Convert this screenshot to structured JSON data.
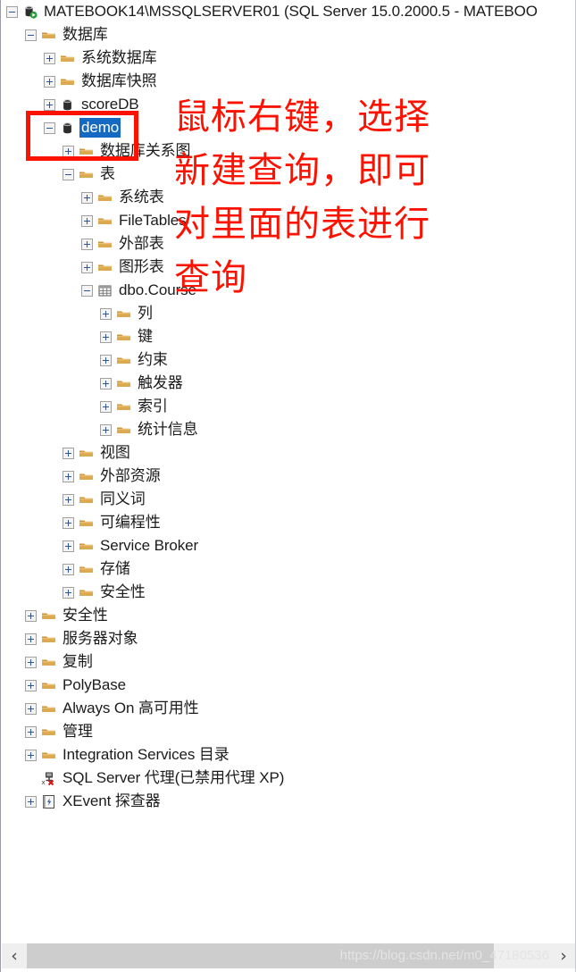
{
  "window": {
    "kind": "object-explorer-tree"
  },
  "tree": {
    "nodes": [
      {
        "level": 0,
        "expander": "minus",
        "icon": "server-connected-icon",
        "label": "MATEBOOK14\\MSSQLSERVER01 (SQL Server 15.0.2000.5 - MATEBOO",
        "selected": false
      },
      {
        "level": 1,
        "expander": "minus",
        "icon": "folder-icon",
        "label": "数据库",
        "selected": false
      },
      {
        "level": 2,
        "expander": "plus",
        "icon": "folder-icon",
        "label": "系统数据库",
        "selected": false
      },
      {
        "level": 2,
        "expander": "plus",
        "icon": "folder-icon",
        "label": "数据库快照",
        "selected": false
      },
      {
        "level": 2,
        "expander": "plus",
        "icon": "database-icon",
        "label": "scoreDB",
        "selected": false
      },
      {
        "level": 2,
        "expander": "minus",
        "icon": "database-icon",
        "label": "demo",
        "selected": true
      },
      {
        "level": 3,
        "expander": "plus",
        "icon": "folder-icon",
        "label": "数据库关系图",
        "selected": false
      },
      {
        "level": 3,
        "expander": "minus",
        "icon": "folder-icon",
        "label": "表",
        "selected": false
      },
      {
        "level": 4,
        "expander": "plus",
        "icon": "folder-icon",
        "label": "系统表",
        "selected": false
      },
      {
        "level": 4,
        "expander": "plus",
        "icon": "folder-icon",
        "label": "FileTables",
        "selected": false
      },
      {
        "level": 4,
        "expander": "plus",
        "icon": "folder-icon",
        "label": "外部表",
        "selected": false
      },
      {
        "level": 4,
        "expander": "plus",
        "icon": "folder-icon",
        "label": "图形表",
        "selected": false
      },
      {
        "level": 4,
        "expander": "minus",
        "icon": "table-icon",
        "label": "dbo.Course",
        "selected": false
      },
      {
        "level": 5,
        "expander": "plus",
        "icon": "folder-icon",
        "label": "列",
        "selected": false
      },
      {
        "level": 5,
        "expander": "plus",
        "icon": "folder-icon",
        "label": "键",
        "selected": false
      },
      {
        "level": 5,
        "expander": "plus",
        "icon": "folder-icon",
        "label": "约束",
        "selected": false
      },
      {
        "level": 5,
        "expander": "plus",
        "icon": "folder-icon",
        "label": "触发器",
        "selected": false
      },
      {
        "level": 5,
        "expander": "plus",
        "icon": "folder-icon",
        "label": "索引",
        "selected": false
      },
      {
        "level": 5,
        "expander": "plus",
        "icon": "folder-icon",
        "label": "统计信息",
        "selected": false
      },
      {
        "level": 3,
        "expander": "plus",
        "icon": "folder-icon",
        "label": "视图",
        "selected": false
      },
      {
        "level": 3,
        "expander": "plus",
        "icon": "folder-icon",
        "label": "外部资源",
        "selected": false
      },
      {
        "level": 3,
        "expander": "plus",
        "icon": "folder-icon",
        "label": "同义词",
        "selected": false
      },
      {
        "level": 3,
        "expander": "plus",
        "icon": "folder-icon",
        "label": "可编程性",
        "selected": false
      },
      {
        "level": 3,
        "expander": "plus",
        "icon": "folder-icon",
        "label": "Service Broker",
        "selected": false
      },
      {
        "level": 3,
        "expander": "plus",
        "icon": "folder-icon",
        "label": "存储",
        "selected": false
      },
      {
        "level": 3,
        "expander": "plus",
        "icon": "folder-icon",
        "label": "安全性",
        "selected": false
      },
      {
        "level": 1,
        "expander": "plus",
        "icon": "folder-icon",
        "label": "安全性",
        "selected": false
      },
      {
        "level": 1,
        "expander": "plus",
        "icon": "folder-icon",
        "label": "服务器对象",
        "selected": false
      },
      {
        "level": 1,
        "expander": "plus",
        "icon": "folder-icon",
        "label": "复制",
        "selected": false
      },
      {
        "level": 1,
        "expander": "plus",
        "icon": "folder-icon",
        "label": "PolyBase",
        "selected": false
      },
      {
        "level": 1,
        "expander": "plus",
        "icon": "folder-icon",
        "label": "Always On 高可用性",
        "selected": false
      },
      {
        "level": 1,
        "expander": "plus",
        "icon": "folder-icon",
        "label": "管理",
        "selected": false
      },
      {
        "level": 1,
        "expander": "plus",
        "icon": "folder-icon",
        "label": "Integration Services 目录",
        "selected": false
      },
      {
        "level": 1,
        "expander": "none",
        "icon": "sql-agent-disabled-icon",
        "label": "SQL Server 代理(已禁用代理 XP)",
        "selected": false
      },
      {
        "level": 1,
        "expander": "plus",
        "icon": "xevent-icon",
        "label": "XEvent 探查器",
        "selected": false
      }
    ]
  },
  "annotation": {
    "color": "#fc1200",
    "highlight_target": "demo",
    "lines": [
      "鼠标右键，选择",
      "新建查询，即可",
      "对里面的表进行",
      "查询"
    ]
  },
  "scrollbar": {
    "left_arrow": "‹",
    "right_arrow": "›",
    "watermark": "https://blog.csdn.net/m0_47180536"
  },
  "colors": {
    "selection_blue": "#1669c2",
    "folder_tan": "#dda94f",
    "annotation_red": "#fc1200",
    "expander_blue": "#2b5797"
  }
}
